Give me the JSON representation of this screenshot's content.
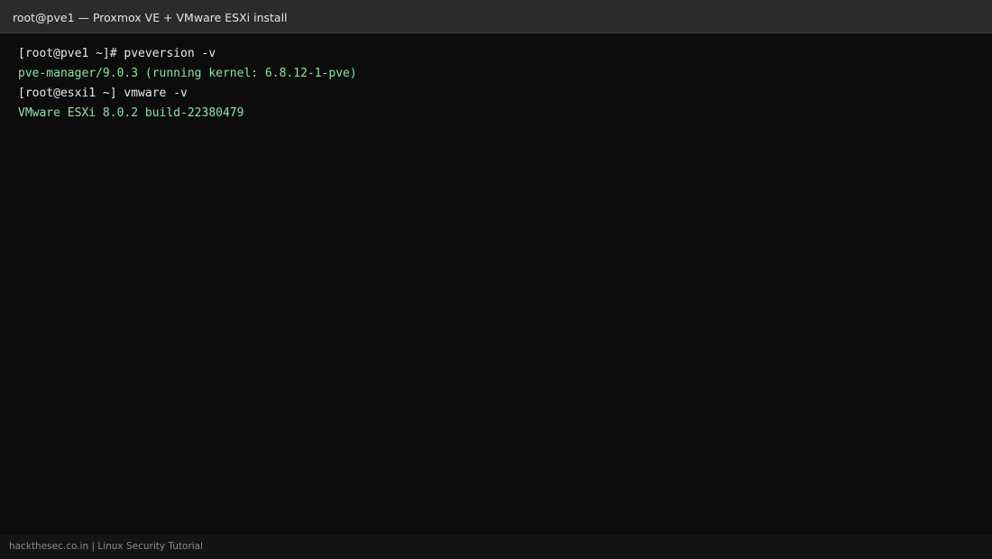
{
  "window": {
    "title": "root@pve1 — Proxmox VE + VMware ESXi install"
  },
  "terminal": {
    "lines": [
      {
        "kind": "command",
        "text": "[root@pve1 ~]# pveversion -v"
      },
      {
        "kind": "output",
        "text": "pve-manager/9.0.3 (running kernel: 6.8.12-1-pve)"
      },
      {
        "kind": "command",
        "text": "[root@esxi1 ~] vmware -v"
      },
      {
        "kind": "output",
        "text": "VMware ESXi 8.0.2 build-22380479"
      }
    ]
  },
  "footer": {
    "text": "hackthesec.co.in | Linux Security Tutorial"
  },
  "colors": {
    "background": "#0c0c0c",
    "titlebar": "#2b2b2b",
    "command_text": "#e8e8e8",
    "output_text": "#8ee0a6",
    "footer_text": "#8a8a8a"
  }
}
